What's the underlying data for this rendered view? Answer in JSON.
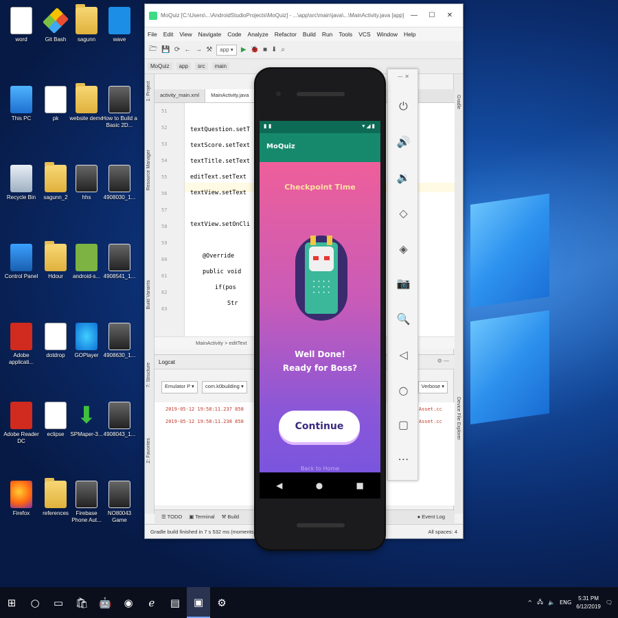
{
  "desktop": {
    "icons": [
      {
        "label": "word",
        "kind": "doc"
      },
      {
        "label": "Git Bash",
        "kind": "gitbash"
      },
      {
        "label": "sagunn",
        "kind": "folder"
      },
      {
        "label": "wave",
        "kind": "plane"
      },
      {
        "label": "This PC",
        "kind": "pc"
      },
      {
        "label": "pk",
        "kind": "doc"
      },
      {
        "label": "website demo",
        "kind": "folder"
      },
      {
        "label": "How to Build a Basic 2D...",
        "kind": "thumb"
      },
      {
        "label": "Recycle Bin",
        "kind": "bin"
      },
      {
        "label": "sagunn_2",
        "kind": "folder"
      },
      {
        "label": "hhs",
        "kind": "thumb"
      },
      {
        "label": "4908030_1...",
        "kind": "thumb"
      },
      {
        "label": "Control Panel",
        "kind": "ctrl"
      },
      {
        "label": "Hdour",
        "kind": "folder"
      },
      {
        "label": "android-s...",
        "kind": "android"
      },
      {
        "label": "4908541_1...",
        "kind": "thumb"
      },
      {
        "label": "Adobe applicati...",
        "kind": "pdf"
      },
      {
        "label": "dotdrop",
        "kind": "doc"
      },
      {
        "label": "GOPlayer",
        "kind": "ring"
      },
      {
        "label": "4908630_1...",
        "kind": "thumb"
      },
      {
        "label": "Adobe Reader DC",
        "kind": "pdf"
      },
      {
        "label": "eclipse",
        "kind": "doc"
      },
      {
        "label": "SPMaper-3...",
        "kind": "arrow"
      },
      {
        "label": "4908043_1...",
        "kind": "thumb"
      },
      {
        "label": "Firefox",
        "kind": "firefox"
      },
      {
        "label": "references",
        "kind": "folder"
      },
      {
        "label": "Firebase Phone Aut...",
        "kind": "thumb"
      },
      {
        "label": "NO80043 Game",
        "kind": "thumb"
      }
    ]
  },
  "ide": {
    "title": "MoQuiz [C:\\Users\\...\\AndroidStudioProjects\\MoQuiz] - ...\\app\\src\\main\\java\\...\\MainActivity.java [app] - Android Studio",
    "menu": [
      "File",
      "Edit",
      "View",
      "Navigate",
      "Code",
      "Analyze",
      "Refactor",
      "Build",
      "Run",
      "Tools",
      "VCS",
      "Window",
      "Help"
    ],
    "run_config": "app",
    "nav_crumbs": [
      "MoQuiz",
      "app",
      "src",
      "main"
    ],
    "editor_tabs": [
      "activity_main.xml",
      "MainActivity.java"
    ],
    "code_lines": [
      "textQuestion.setT",
      "textScore.setText",
      "textTitle.setText",
      "editText.setText",
      "textView.setText",
      "",
      "textView.setOnCli",
      "",
      "@Override",
      "public void",
      "if(pos",
      "Str"
    ],
    "line_numbers": [
      "51",
      "52",
      "53",
      "54",
      "55",
      "56",
      "57",
      "58",
      "59",
      "60",
      "61",
      "62",
      "63"
    ],
    "editor_crumb": "MainActivity  >  editText",
    "logcat_title": "Logcat",
    "logcat_device": "Emulator P",
    "logcat_package": "com.k0building",
    "logcat_level": "Verbose",
    "log_lines": [
      "2019-05-12 19:58:11.237 858",
      "2019-05-12 19:58:11.238 858"
    ],
    "log_right_lines": [
      "Asset.cc",
      "Asset.cc"
    ],
    "bottom_tabs": [
      "TODO",
      "Terminal",
      "Build"
    ],
    "event_log": "Event Log",
    "status_text": "Gradle build finished in 7 s 532 ms (moments ago)",
    "status_right": "All spaces: 4"
  },
  "phone": {
    "status_time": "",
    "app_title": "MoQuiz",
    "checkpoint_title": "Checkpoint Time",
    "message_line1": "Well Done!",
    "message_line2": "Ready for Boss?",
    "continue_label": "Continue",
    "back_home": "Back to Home"
  },
  "taskbar": {
    "time": "5:31 PM",
    "date": "6/12/2019",
    "lang": "ENG"
  },
  "colors": {
    "gradient_top": "#ee5f9a",
    "gradient_bottom": "#7a55de",
    "appbar": "#16896c",
    "statusbar": "#0d6b55"
  }
}
